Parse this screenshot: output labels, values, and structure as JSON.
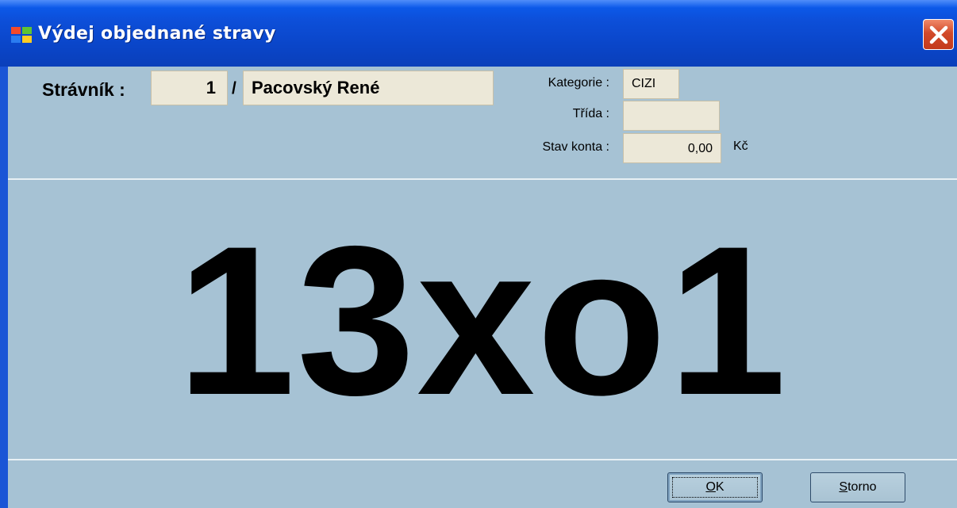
{
  "window": {
    "title": "Výdej objednané stravy",
    "title_icon": "windows-flag-icon",
    "close_icon": "close-icon"
  },
  "diner": {
    "label": "Strávník :",
    "number": "1",
    "separator": "/",
    "name": "Pacovský René"
  },
  "info": {
    "category_label": "Kategorie :",
    "category_value": "CIZI",
    "class_label": "Třída :",
    "class_value": "",
    "balance_label": "Stav konta :",
    "balance_value": "0,00",
    "currency": "Kč"
  },
  "order": {
    "code": "13xo1"
  },
  "buttons": {
    "ok_hotkey": "O",
    "ok_rest": "K",
    "storno_hotkey": "S",
    "storno_rest": "torno"
  },
  "colors": {
    "titlebar": "#0a4fd9",
    "client_bg": "#a6c2d4",
    "field_bg": "#ece8d8",
    "close_button": "#d24a2a"
  }
}
